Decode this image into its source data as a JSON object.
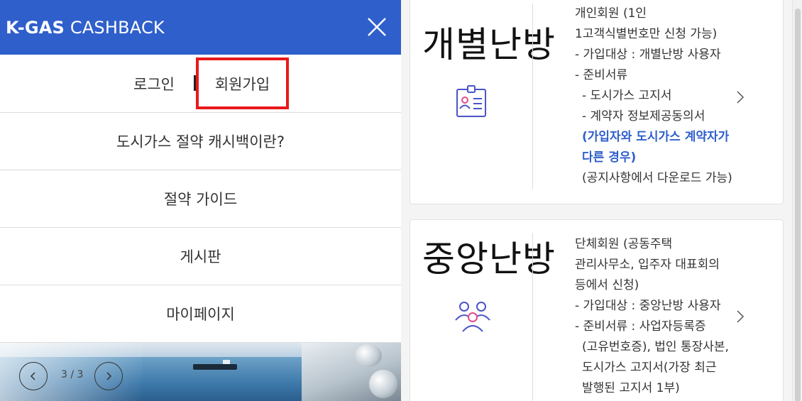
{
  "header": {
    "brand_bold": "K-GAS",
    "brand_light": " CASHBACK",
    "accent_color": "#2f5fcb"
  },
  "auth": {
    "login": "로그인",
    "signup": "회원가입",
    "highlight_color": "#e8191b"
  },
  "menu": {
    "items": [
      {
        "label": "도시가스 절약 캐시백이란?"
      },
      {
        "label": "절약 가이드"
      },
      {
        "label": "게시판"
      },
      {
        "label": "마이페이지"
      }
    ]
  },
  "banner": {
    "counter": "3 / 3"
  },
  "cards": [
    {
      "title": "개별난방",
      "icon": "id-card-icon",
      "lines": [
        {
          "text": "개인회원 (1인",
          "style": "normal"
        },
        {
          "text": "1고객식별번호만 신청 가능)",
          "style": "normal"
        },
        {
          "text": "- 가입대상 : 개별난방 사용자",
          "style": "normal"
        },
        {
          "text": "- 준비서류",
          "style": "normal"
        },
        {
          "text": "- 도시가스 고지서",
          "style": "ind"
        },
        {
          "text": "- 계약자 정보제공동의서",
          "style": "ind"
        },
        {
          "text": "(가입자와 도시가스 계약자가",
          "style": "blue"
        },
        {
          "text": "다른 경우)",
          "style": "blue"
        },
        {
          "text": "(공지사항에서 다운로드 가능)",
          "style": "ind"
        }
      ]
    },
    {
      "title": "중앙난방",
      "icon": "group-icon",
      "lines": [
        {
          "text": "단체회원 (공동주택",
          "style": "normal"
        },
        {
          "text": "관리사무소, 입주자 대표회의",
          "style": "normal"
        },
        {
          "text": "등에서 신청)",
          "style": "normal"
        },
        {
          "text": "- 가입대상 : 중앙난방 사용자",
          "style": "normal"
        },
        {
          "text": "- 준비서류 : 사업자등록증",
          "style": "normal"
        },
        {
          "text": "(고유번호증), 법인 통장사본,",
          "style": "ind"
        },
        {
          "text": "도시가스 고지서(가장 최근",
          "style": "ind"
        },
        {
          "text": "발행된 고지서 1부)",
          "style": "ind"
        }
      ]
    }
  ]
}
